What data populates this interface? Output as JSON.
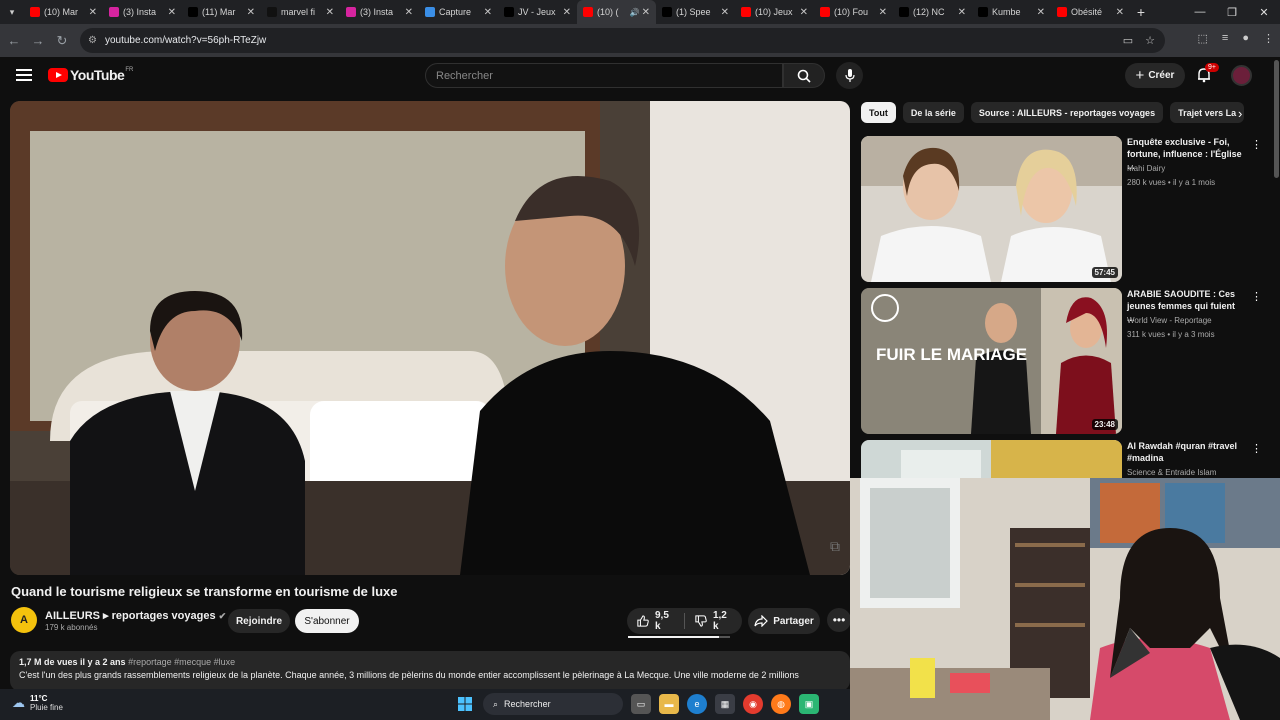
{
  "browser": {
    "tabs": [
      {
        "title": "(10) Mar",
        "icon": "youtube-icon",
        "color": "#ff0000"
      },
      {
        "title": "(3) Insta",
        "icon": "instagram-icon",
        "color": "#d6249f"
      },
      {
        "title": "(11) Mar",
        "icon": "x-icon",
        "color": "#000000"
      },
      {
        "title": "marvel fi",
        "icon": "tiktok-icon",
        "color": "#111111"
      },
      {
        "title": "(3) Insta",
        "icon": "instagram-icon",
        "color": "#d6249f"
      },
      {
        "title": "Capture",
        "icon": "capture-icon",
        "color": "#3a8ee6"
      },
      {
        "title": "JV - Jeux",
        "icon": "x-icon",
        "color": "#000000"
      },
      {
        "title": "(10) (",
        "icon": "youtube-icon",
        "color": "#ff0000",
        "active": true
      },
      {
        "title": "(1) Spee",
        "icon": "x-icon",
        "color": "#000000"
      },
      {
        "title": "(10) Jeux",
        "icon": "youtube-icon",
        "color": "#ff0000"
      },
      {
        "title": "(10) Fou",
        "icon": "youtube-icon",
        "color": "#ff0000"
      },
      {
        "title": "(12) NC",
        "icon": "x-icon",
        "color": "#000000"
      },
      {
        "title": "Kumbe",
        "icon": "x-icon",
        "color": "#000000"
      },
      {
        "title": "Obésité",
        "icon": "youtube-icon",
        "color": "#ff0000"
      }
    ],
    "url": "youtube.com/watch?v=56ph-RTeZjw"
  },
  "header": {
    "logo_text": "YouTube",
    "logo_country": "FR",
    "search_placeholder": "Rechercher",
    "create_label": "Créer",
    "notif_badge": "9+"
  },
  "video": {
    "title": "Quand le tourisme religieux se transforme en tourisme de luxe",
    "channel": "AILLEURS ▸ reportages voyages",
    "channel_initial": "A",
    "subscribers": "179 k abonnés",
    "join_label": "Rejoindre",
    "subscribe_label": "S'abonner",
    "likes": "9,5 k",
    "dislikes": "1,2 k",
    "like_ratio": 0.89,
    "share_label": "Partager",
    "description_meta": "1,7 M de vues  il y a 2 ans",
    "description_tags": "#reportage #mecque #luxe",
    "description_text": "C'est l'un des plus grands rassemblements religieux de la planète. Chaque année, 3 millions de pèlerins du monde entier accomplissent le pèlerinage à La Mecque. Une ville moderne de 2 millions"
  },
  "chips": [
    "Tout",
    "De la série",
    "Source : AILLEURS - reportages voyages",
    "Trajet vers La"
  ],
  "recommendations": [
    {
      "title": "Enquête exclusive - Foi, fortune, influence : l'Église ...",
      "channel": "Mahi Dairy",
      "views": "280 k vues • il y a 1 mois",
      "duration": "57:45"
    },
    {
      "title": "ARABIE SAOUDITE : Ces jeunes femmes qui fuient ...",
      "channel": "World View - Reportage",
      "views": "311 k vues • il y a 3 mois",
      "duration": "23:48",
      "thumb_text": "FUIR LE MARIAGE"
    },
    {
      "title": "Al Rawdah #quran #travel #madina",
      "channel": "Science & Entraide Islam",
      "views": "",
      "duration": ""
    }
  ],
  "taskbar": {
    "temp": "11°C",
    "weather": "Pluie fine",
    "search_label": "Rechercher"
  }
}
